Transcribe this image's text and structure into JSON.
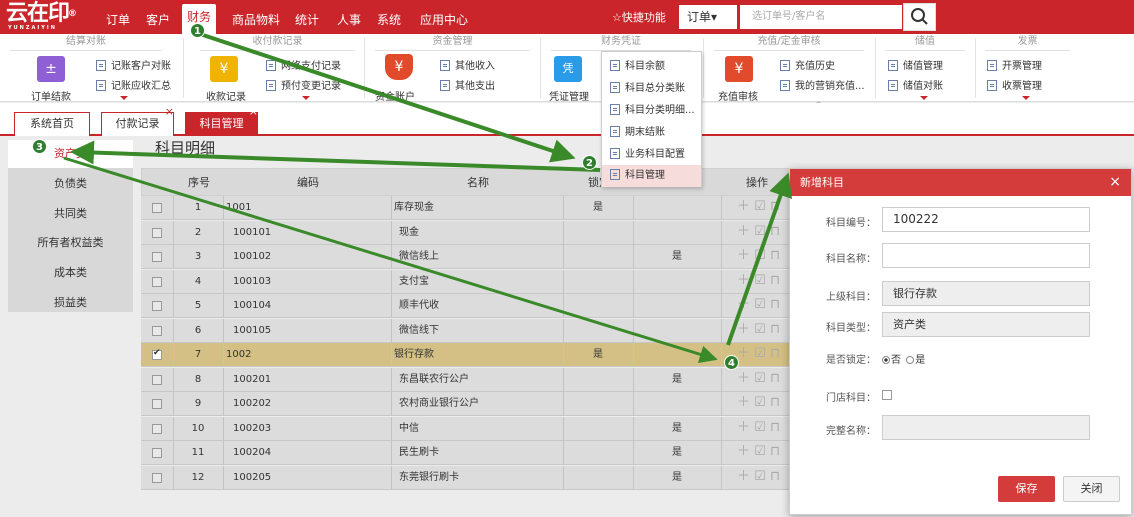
{
  "topbar": {
    "logo_text": "云在印",
    "logo_reg": "®",
    "logo_sub": "YUNZAIYIN",
    "nav": [
      "订单",
      "客户",
      "财务",
      "商品物料",
      "统计",
      "人事",
      "系统",
      "应用中心"
    ],
    "quick": "☆快捷功能",
    "order_dropdown": "订单▾",
    "search_placeholder": "选订单号/客户名"
  },
  "ribbon": {
    "groups": [
      "结算对账",
      "收付款记录",
      "资金管理",
      "财务凭证",
      "充值/定金审核",
      "储值",
      "发票"
    ],
    "order_settle": "订单结款",
    "recv_record": "收款记录",
    "fund_account": "资金账户",
    "voucher_mgmt": "凭证管理",
    "recharge_audit": "充值审核",
    "items": {
      "a1": "记账客户对账",
      "a2": "记账应收汇总",
      "b1": "网络支付记录",
      "b2": "预付变更记录",
      "c1": "其他收入",
      "c2": "其他支出",
      "e1": "充值历史",
      "e2": "我的营销充值...",
      "f1": "储值管理",
      "f2": "储值对账",
      "g1": "开票管理",
      "g2": "收票管理"
    }
  },
  "dropdown": [
    "科目余额",
    "科目总分类账",
    "科目分类明细...",
    "期末结账",
    "业务科目配置",
    "科目管理"
  ],
  "tabs": [
    "系统首页",
    "付款记录",
    "科目管理"
  ],
  "categories": [
    "资产类",
    "负债类",
    "共同类",
    "所有者权益类",
    "成本类",
    "损益类"
  ],
  "page_title": "科目明细",
  "table": {
    "headers": [
      "序号",
      "编码",
      "名称",
      "锁定",
      "操作"
    ],
    "rows": [
      {
        "no": "1",
        "code": "1001",
        "name": "库存现金",
        "lock": "是",
        "other": ""
      },
      {
        "no": "2",
        "code": "100101",
        "name": "现金",
        "lock": "",
        "other": ""
      },
      {
        "no": "3",
        "code": "100102",
        "name": "微信线上",
        "lock": "",
        "other": "是"
      },
      {
        "no": "4",
        "code": "100103",
        "name": "支付宝",
        "lock": "",
        "other": ""
      },
      {
        "no": "5",
        "code": "100104",
        "name": "顺丰代收",
        "lock": "",
        "other": ""
      },
      {
        "no": "6",
        "code": "100105",
        "name": "微信线下",
        "lock": "",
        "other": ""
      },
      {
        "no": "7",
        "code": "1002",
        "name": "银行存款",
        "lock": "是",
        "other": ""
      },
      {
        "no": "8",
        "code": "100201",
        "name": "东昌联农行公户",
        "lock": "",
        "other": "是"
      },
      {
        "no": "9",
        "code": "100202",
        "name": "农村商业银行公户",
        "lock": "",
        "other": ""
      },
      {
        "no": "10",
        "code": "100203",
        "name": "中信",
        "lock": "",
        "other": "是"
      },
      {
        "no": "11",
        "code": "100204",
        "name": "民生刷卡",
        "lock": "",
        "other": "是"
      },
      {
        "no": "12",
        "code": "100205",
        "name": "东莞银行刷卡",
        "lock": "",
        "other": "是"
      }
    ]
  },
  "modal": {
    "title": "新增科目",
    "close": "×",
    "label_code": "科目编号：",
    "value_code": "100222",
    "label_name": "科目名称：",
    "value_name": "",
    "label_parent": "上级科目：",
    "value_parent": "银行存款",
    "label_type": "科目类型：",
    "value_type": "资产类",
    "label_lock": "是否锁定：",
    "lock_no": "否",
    "lock_yes": "是",
    "label_store": "门店科目：",
    "label_fullname": "完整名称：",
    "value_fullname": "",
    "save": "保存",
    "cancel": "关闭"
  },
  "badges": [
    "1",
    "2",
    "3",
    "4"
  ],
  "colors": {
    "brand": "#c9252b",
    "arrow": "#3a8a2a",
    "selected_row": "#d4c085"
  }
}
